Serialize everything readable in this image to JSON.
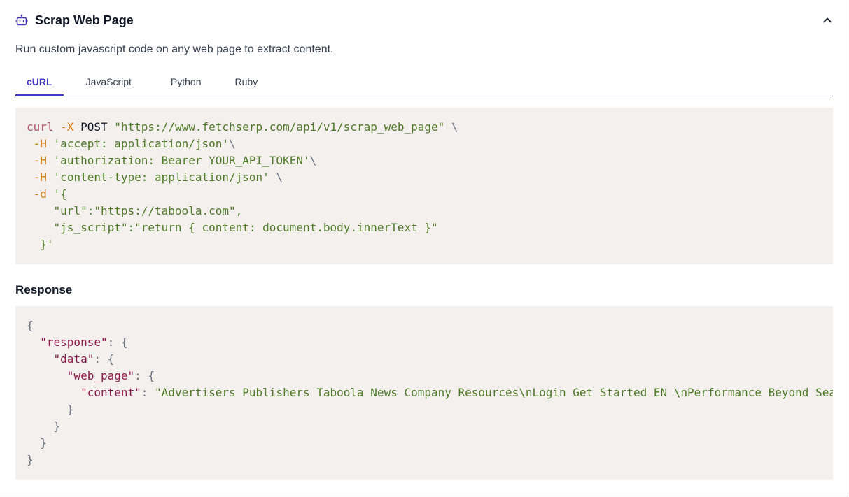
{
  "header": {
    "title": "Scrap Web Page",
    "icon": "robot-icon",
    "collapse_icon": "chevron-up-icon"
  },
  "description": "Run custom javascript code on any web page to extract content.",
  "tabs": [
    {
      "label": "cURL",
      "active": true
    },
    {
      "label": "JavaScript",
      "active": false
    },
    {
      "label": "Python",
      "active": false
    },
    {
      "label": "Ruby",
      "active": false
    }
  ],
  "request": {
    "cmd": "curl",
    "method_flag": "-X",
    "method": "POST",
    "url": "\"https://www.fetchserp.com/api/v1/scrap_web_page\"",
    "continuation": "\\",
    "h_flag": "-H",
    "h1": "'accept: application/json'",
    "h2": "'authorization: Bearer YOUR_API_TOKEN'",
    "h3": "'content-type: application/json'",
    "d_flag": "-d",
    "body_open": "'{",
    "body_url": "\"url\":\"https://taboola.com\",",
    "body_js": "\"js_script\":\"return { content: document.body.innerText }\"",
    "body_close": "}'"
  },
  "response_title": "Response",
  "response": {
    "brace_open": "{",
    "brace_close": "}",
    "colon": ":",
    "k_response": "\"response\"",
    "k_data": "\"data\"",
    "k_web_page": "\"web_page\"",
    "k_content": "\"content\"",
    "v_content": "\"Advertisers Publishers Taboola News Company Resources\\nLogin Get Started EN \\nPerformance Beyond Search"
  },
  "colors": {
    "accent": "#4338ca",
    "code_bg": "#f3f0ed",
    "string": "#4f7a28",
    "flag": "#d97706",
    "key": "#8b1a4a"
  }
}
